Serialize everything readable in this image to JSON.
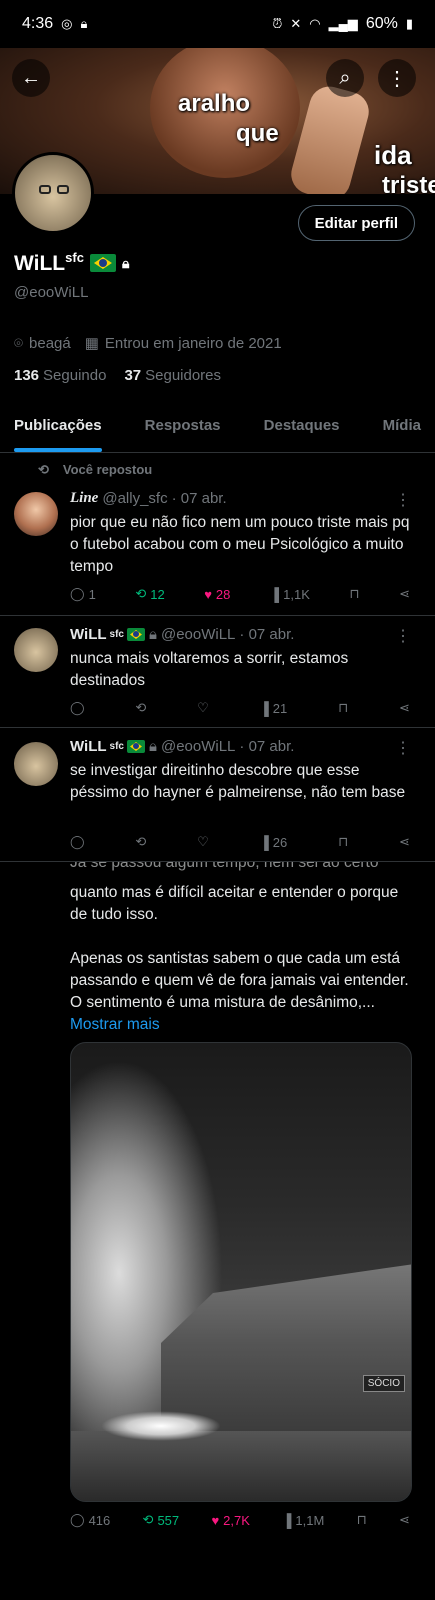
{
  "status": {
    "time": "4:36",
    "battery": "60%"
  },
  "banner": {
    "line1": "aralho",
    "line2": "que",
    "line3": "ida",
    "line4": "triste"
  },
  "profile": {
    "name": "WiLL",
    "sup": "sfc",
    "handle": "@eooWiLL",
    "edit_label": "Editar perfil",
    "location": "beagá",
    "joined": "Entrou em janeiro de 2021",
    "following_count": "136",
    "following_label": "Seguindo",
    "followers_count": "37",
    "followers_label": "Seguidores"
  },
  "tabs": [
    "Publicações",
    "Respostas",
    "Destaques",
    "Mídia"
  ],
  "repost_label": "Você repostou",
  "tweets": [
    {
      "name": "Line",
      "handle": "@ally_sfc",
      "date": "· 07 abr.",
      "text": "pior que eu não fico nem um pouco triste mais pq o futebol acabou com o meu Psicológico a muito tempo",
      "replies": "1",
      "retweets": "12",
      "likes": "28",
      "views": "1,1K"
    },
    {
      "name": "WiLL",
      "sup": "sfc",
      "handle": "@eooWiLL",
      "date": "· 07 abr.",
      "text": "nunca mais voltaremos a sorrir, estamos destinados",
      "replies": "",
      "retweets": "",
      "likes": "",
      "views": "21"
    },
    {
      "name": "WiLL",
      "sup": "sfc",
      "handle": "@eooWiLL",
      "date": "· 07 abr.",
      "text": "se investigar direitinho descobre que esse péssimo do hayner é palmeirense, não tem base",
      "replies": "",
      "retweets": "",
      "likes": "",
      "views": "26"
    }
  ],
  "long_post": {
    "partial_top": "Já se passou algum tempo, nem sei ao certo",
    "para1": "quanto mas é difícil aceitar e entender o porque de tudo isso.",
    "para2": "Apenas os santistas sabem o que cada um está passando e quem vê de fora jamais vai entender. O sentimento é uma mistura de desânimo,...",
    "more": "Mostrar mais",
    "image_sign": "SÓCIO",
    "replies": "416",
    "retweets": "557",
    "likes": "2,7K",
    "views": "1,1M"
  },
  "colors": {
    "accent": "#1d9bf0",
    "retweet": "#00ba7c",
    "like": "#f91880",
    "muted": "#71767b"
  }
}
